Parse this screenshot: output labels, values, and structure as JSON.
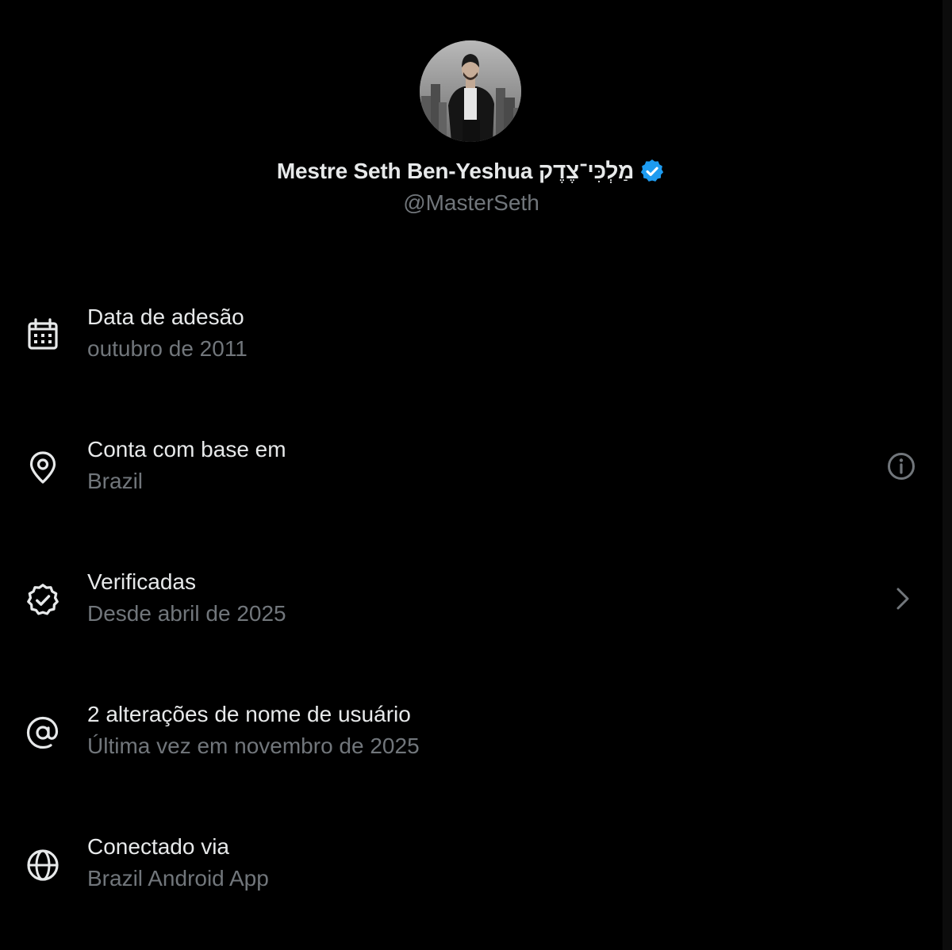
{
  "profile": {
    "display_name": "Mestre Seth Ben-Yeshua מַלְכִּי־צֶדֶק",
    "handle": "@MasterSeth",
    "verified_badge_icon": "verified-badge-icon",
    "avatar": "profile-photo",
    "badge_color": "#1d9bf0"
  },
  "about": {
    "items": [
      {
        "icon": "calendar-icon",
        "title": "Data de adesão",
        "value": "outubro de 2011"
      },
      {
        "icon": "location-pin-icon",
        "title": "Conta com base em",
        "value": "Brazil",
        "action_icon": "info-icon"
      },
      {
        "icon": "verified-outline-icon",
        "title": "Verificadas",
        "value": "Desde abril de 2025",
        "action_icon": "chevron-right-icon"
      },
      {
        "icon": "at-sign-icon",
        "title": "2 alterações de nome de usuário",
        "value": "Última vez em novembro de 2025"
      },
      {
        "icon": "globe-icon",
        "title": "Conectado via",
        "value": "Brazil Android App"
      }
    ]
  },
  "colors": {
    "background": "#000000",
    "primary_text": "#e7e9ea",
    "secondary_text": "#71767b"
  }
}
